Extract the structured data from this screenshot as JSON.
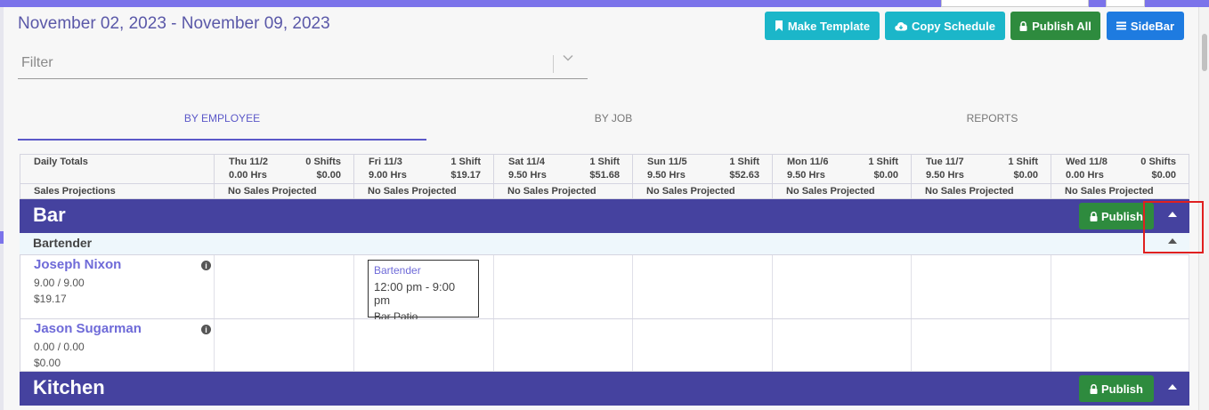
{
  "header": {
    "date_range": "November 02, 2023 - November 09, 2023",
    "buttons": [
      {
        "label": "Make Template",
        "icon": "bookmark-icon"
      },
      {
        "label": "Copy Schedule",
        "icon": "cloud-download-icon"
      },
      {
        "label": "Publish All",
        "icon": "lock-icon"
      },
      {
        "label": "SideBar",
        "icon": "menu-icon"
      }
    ]
  },
  "filter": {
    "placeholder": "Filter"
  },
  "tabs": [
    {
      "label": "BY EMPLOYEE",
      "active": true
    },
    {
      "label": "BY JOB",
      "active": false
    },
    {
      "label": "REPORTS",
      "active": false
    }
  ],
  "totals": {
    "label": "Daily Totals",
    "days": [
      {
        "day": "Thu 11/2",
        "shifts": "0 Shifts",
        "hrs": "0.00 Hrs",
        "cost": "$0.00"
      },
      {
        "day": "Fri 11/3",
        "shifts": "1 Shift",
        "hrs": "9.00 Hrs",
        "cost": "$19.17"
      },
      {
        "day": "Sat 11/4",
        "shifts": "1 Shift",
        "hrs": "9.50 Hrs",
        "cost": "$51.68"
      },
      {
        "day": "Sun 11/5",
        "shifts": "1 Shift",
        "hrs": "9.50 Hrs",
        "cost": "$52.63"
      },
      {
        "day": "Mon 11/6",
        "shifts": "1 Shift",
        "hrs": "9.50 Hrs",
        "cost": "$0.00"
      },
      {
        "day": "Tue 11/7",
        "shifts": "1 Shift",
        "hrs": "9.50 Hrs",
        "cost": "$0.00"
      },
      {
        "day": "Wed 11/8",
        "shifts": "0 Shifts",
        "hrs": "0.00 Hrs",
        "cost": "$0.00"
      }
    ]
  },
  "sales": {
    "label": "Sales Projections",
    "values": [
      "No Sales Projected",
      "No Sales Projected",
      "No Sales Projected",
      "No Sales Projected",
      "No Sales Projected",
      "No Sales Projected",
      "No Sales Projected"
    ]
  },
  "groups": [
    {
      "name": "Bar",
      "publish_label": "Publish",
      "job": "Bartender",
      "employees": [
        {
          "name": "Joseph Nixon",
          "hours": "9.00 / 9.00",
          "cost": "$19.17",
          "info": "i",
          "shift": {
            "job": "Bartender",
            "time": "12:00 pm - 9:00 pm",
            "location": "Bar Patio"
          }
        },
        {
          "name": "Jason Sugarman",
          "hours": "0.00 / 0.00",
          "cost": "$0.00",
          "info": "i"
        }
      ]
    },
    {
      "name": "Kitchen",
      "publish_label": "Publish"
    }
  ],
  "colors": {
    "accent": "#7b73ea",
    "group_bar": "#45429f",
    "teal_button": "#1bb6c9",
    "green_button": "#2e8b3e",
    "blue_button": "#1e7be0",
    "highlight_box": "#e02020"
  }
}
